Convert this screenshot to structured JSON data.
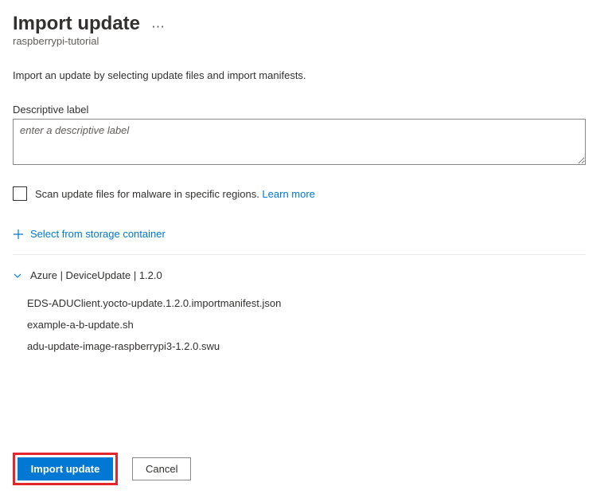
{
  "header": {
    "title": "Import update",
    "subtitle": "raspberrypi-tutorial"
  },
  "intro": "Import an update by selecting update files and import manifests.",
  "descriptiveLabel": {
    "label": "Descriptive label",
    "placeholder": "enter a descriptive label"
  },
  "scanMalware": {
    "label": "Scan update files for malware in specific regions. ",
    "learnMore": "Learn more"
  },
  "storageAction": {
    "label": "Select from storage container"
  },
  "updateGroup": {
    "title": "Azure | DeviceUpdate | 1.2.0",
    "files": [
      "EDS-ADUClient.yocto-update.1.2.0.importmanifest.json",
      "example-a-b-update.sh",
      "adu-update-image-raspberrypi3-1.2.0.swu"
    ]
  },
  "footer": {
    "primary": "Import update",
    "secondary": "Cancel"
  }
}
